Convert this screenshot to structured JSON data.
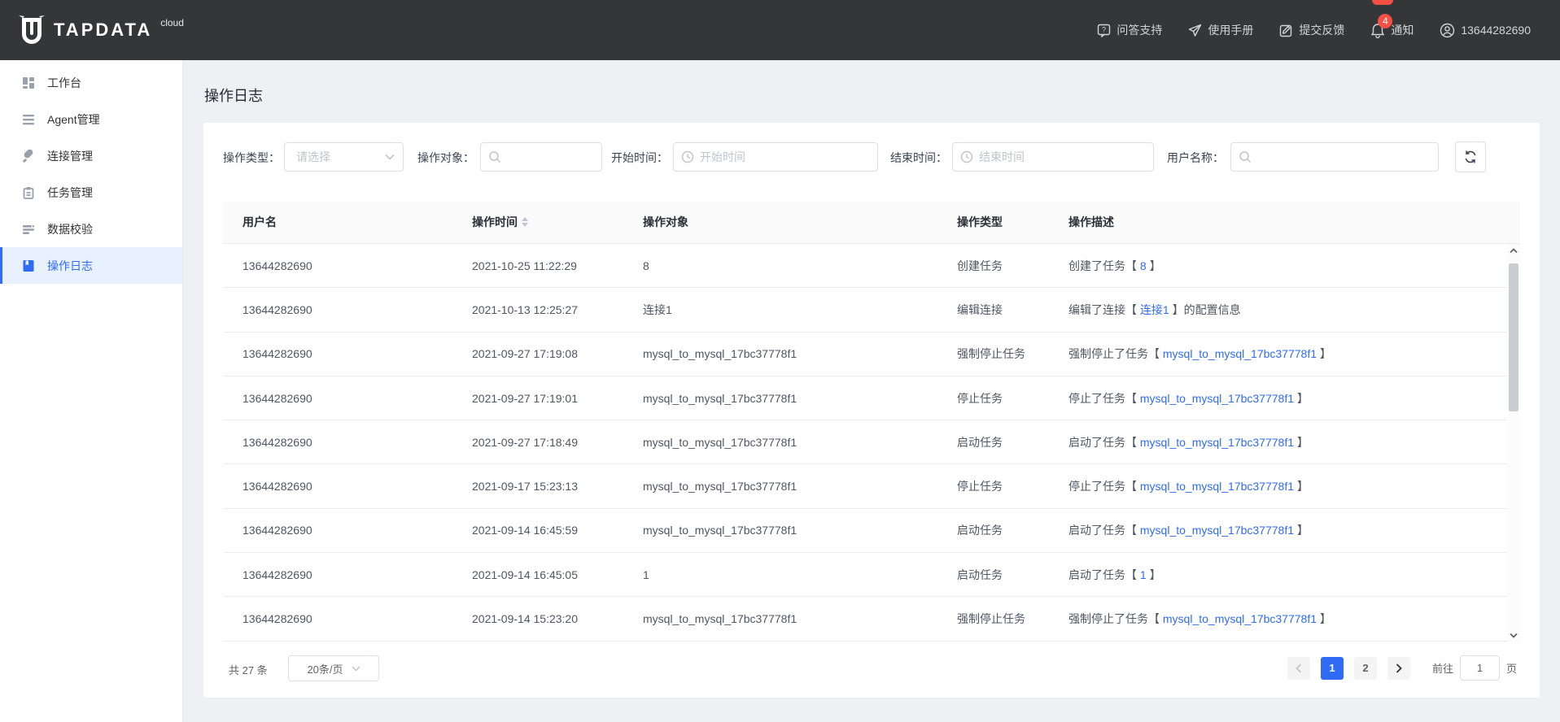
{
  "brand": {
    "name": "TAPDATA",
    "suffix": "cloud"
  },
  "colors": {
    "accent": "#2f6bf5",
    "header_bg": "#343638",
    "badge_red": "#f54e45",
    "page_bg": "#eef0f4"
  },
  "topnav": {
    "help": "问答支持",
    "manual": "使用手册",
    "feedback": "提交反馈",
    "notice": "通知",
    "notice_badge": "4",
    "user": "13644282690"
  },
  "sidebar": {
    "items": [
      {
        "label": "工作台"
      },
      {
        "label": "Agent管理"
      },
      {
        "label": "连接管理"
      },
      {
        "label": "任务管理"
      },
      {
        "label": "数据校验"
      },
      {
        "label": "操作日志"
      }
    ]
  },
  "page": {
    "title": "操作日志"
  },
  "filters": {
    "type_label": "操作类型：",
    "type_placeholder": "请选择",
    "target_label": "操作对象：",
    "start_label": "开始时间：",
    "start_placeholder": "开始时间",
    "end_label": "结束时间：",
    "end_placeholder": "结束时间",
    "user_label": "用户名称："
  },
  "table": {
    "columns": [
      "用户名",
      "操作时间",
      "操作对象",
      "操作类型",
      "操作描述"
    ],
    "rows": [
      {
        "user": "13644282690",
        "time": "2021-10-25 11:22:29",
        "target": "8",
        "type": "创建任务",
        "desc_prefix": "创建了任务【 ",
        "desc_link": "8",
        "desc_suffix": " 】"
      },
      {
        "user": "13644282690",
        "time": "2021-10-13 12:25:27",
        "target": "连接1",
        "type": "编辑连接",
        "desc_prefix": "编辑了连接【 ",
        "desc_link": "连接1",
        "desc_suffix": " 】的配置信息"
      },
      {
        "user": "13644282690",
        "time": "2021-09-27 17:19:08",
        "target": "mysql_to_mysql_17bc37778f1",
        "type": "强制停止任务",
        "desc_prefix": "强制停止了任务【 ",
        "desc_link": "mysql_to_mysql_17bc37778f1",
        "desc_suffix": " 】"
      },
      {
        "user": "13644282690",
        "time": "2021-09-27 17:19:01",
        "target": "mysql_to_mysql_17bc37778f1",
        "type": "停止任务",
        "desc_prefix": "停止了任务【 ",
        "desc_link": "mysql_to_mysql_17bc37778f1",
        "desc_suffix": " 】"
      },
      {
        "user": "13644282690",
        "time": "2021-09-27 17:18:49",
        "target": "mysql_to_mysql_17bc37778f1",
        "type": "启动任务",
        "desc_prefix": "启动了任务【 ",
        "desc_link": "mysql_to_mysql_17bc37778f1",
        "desc_suffix": " 】"
      },
      {
        "user": "13644282690",
        "time": "2021-09-17 15:23:13",
        "target": "mysql_to_mysql_17bc37778f1",
        "type": "停止任务",
        "desc_prefix": "停止了任务【 ",
        "desc_link": "mysql_to_mysql_17bc37778f1",
        "desc_suffix": " 】"
      },
      {
        "user": "13644282690",
        "time": "2021-09-14 16:45:59",
        "target": "mysql_to_mysql_17bc37778f1",
        "type": "启动任务",
        "desc_prefix": "启动了任务【 ",
        "desc_link": "mysql_to_mysql_17bc37778f1",
        "desc_suffix": " 】"
      },
      {
        "user": "13644282690",
        "time": "2021-09-14 16:45:05",
        "target": "1",
        "type": "启动任务",
        "desc_prefix": "启动了任务【 ",
        "desc_link": "1",
        "desc_suffix": " 】"
      },
      {
        "user": "13644282690",
        "time": "2021-09-14 15:23:20",
        "target": "mysql_to_mysql_17bc37778f1",
        "type": "强制停止任务",
        "desc_prefix": "强制停止了任务【 ",
        "desc_link": "mysql_to_mysql_17bc37778f1",
        "desc_suffix": " 】"
      }
    ]
  },
  "pagination": {
    "total": "共 27 条",
    "page_size": "20条/页",
    "pages": [
      "1",
      "2"
    ],
    "active_page": "1",
    "goto_label": "前往",
    "goto_value": "1",
    "goto_unit": "页"
  }
}
